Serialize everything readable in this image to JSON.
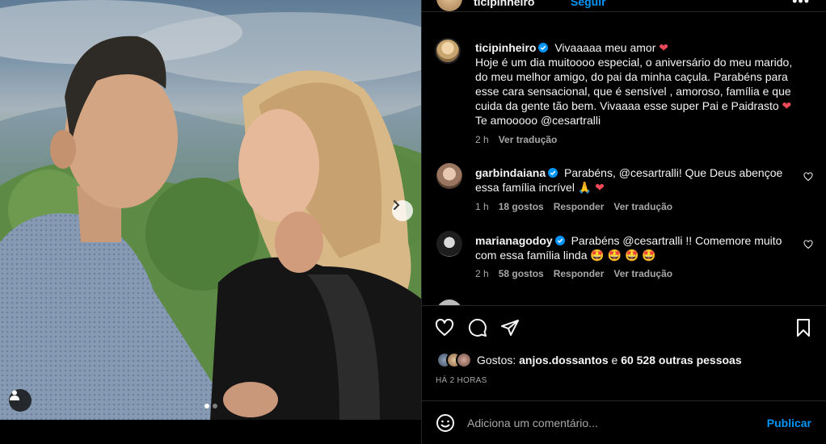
{
  "header": {
    "username": "ticipinheiro",
    "follow_label": "Seguir",
    "more_label": "•••"
  },
  "caption": {
    "username": "ticipinheiro",
    "text_line1": "Vivaaaaa meu amor",
    "text_body": "Hoje é um dia muitoooo especial, o aniversário do meu marido, do meu melhor amigo, do pai da minha caçula. Parabéns para esse cara sensacional, que é sensível , amoroso, família e que cuida da gente tão bem. Vivaaaa esse super Pai e Paidrasto",
    "text_end": "Te amooooo @cesartralli",
    "time": "2 h",
    "translate": "Ver tradução"
  },
  "comments": [
    {
      "username": "garbindaiana",
      "text": "Parabéns, @cesartralli! Que Deus abençoe essa família incrível 🙏",
      "time": "1 h",
      "likes": "18 gostos",
      "reply": "Responder",
      "translate": "Ver tradução"
    },
    {
      "username": "marianagodoy",
      "text": "Parabéns @cesartralli !! Comemore muito com essa família linda 🤩 🤩 🤩 🤩",
      "time": "2 h",
      "likes": "58 gostos",
      "reply": "Responder",
      "translate": "Ver tradução"
    }
  ],
  "likes": {
    "prefix": "Gostos:",
    "first_user": "anjos.dossantos",
    "connector": "e",
    "others": "60 528 outras pessoas"
  },
  "posted_time": "HÁ 2 HORAS",
  "add_comment": {
    "placeholder": "Adiciona um comentário...",
    "publish_label": "Publicar"
  },
  "carousel": {
    "slide_count": 2,
    "active_index": 0
  },
  "colors": {
    "accent": "#0095f6",
    "heart": "#ed4956",
    "background": "#000000"
  }
}
